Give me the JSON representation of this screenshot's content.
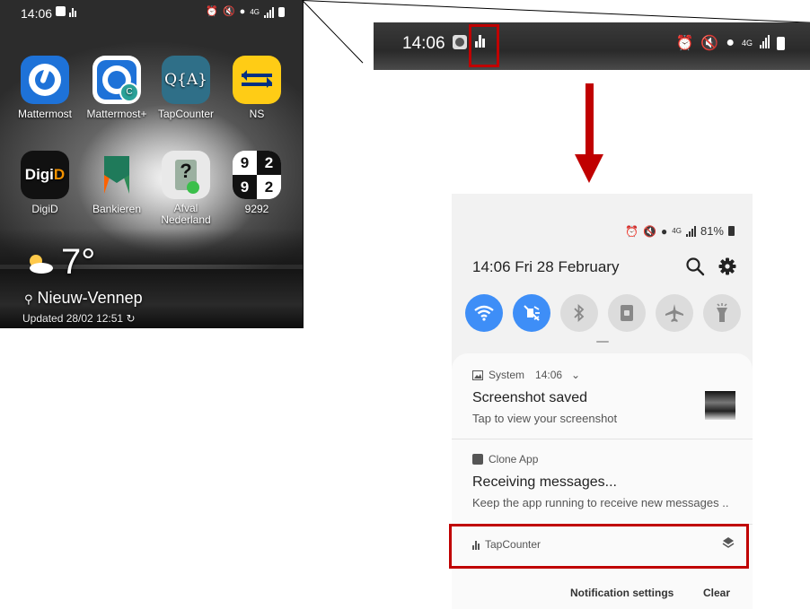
{
  "home": {
    "status_time": "14:06",
    "apps": [
      {
        "label": "Mattermost"
      },
      {
        "label": "Mattermost+"
      },
      {
        "label": "TapCounter",
        "icon_text": "Q{A}"
      },
      {
        "label": "NS"
      },
      {
        "label": "DigiD",
        "icon_text_a": "Digi",
        "icon_text_b": "D"
      },
      {
        "label": "Bankieren"
      },
      {
        "label": "Afval Nederland",
        "icon_text": "?"
      },
      {
        "label": "9292",
        "icon_digits": [
          "9",
          "2",
          "9",
          "2"
        ]
      }
    ],
    "weather_temp": "7°",
    "location": "Nieuw-Vennep",
    "updated": "Updated 28/02 12:51"
  },
  "zoomed_status": {
    "time": "14:06",
    "network": "4G"
  },
  "shade": {
    "network": "4G",
    "battery": "81%",
    "datetime": "14:06  Fri 28 February",
    "quick_settings": [
      {
        "name": "wifi",
        "state": "on"
      },
      {
        "name": "mute",
        "state": "on"
      },
      {
        "name": "bluetooth",
        "state": "off"
      },
      {
        "name": "screen-lock",
        "state": "off"
      },
      {
        "name": "airplane",
        "state": "off"
      },
      {
        "name": "flashlight",
        "state": "off"
      }
    ],
    "notifications": [
      {
        "app": "System",
        "time": "14:06",
        "title": "Screenshot saved",
        "text": "Tap to view your screenshot"
      },
      {
        "app": "Clone App",
        "title": "Receiving messages...",
        "text": "Keep the app running to receive new messages .."
      },
      {
        "app": "TapCounter"
      }
    ],
    "footer": {
      "settings": "Notification settings",
      "clear": "Clear"
    }
  },
  "colors": {
    "highlight": "#c00000",
    "toggle_on": "#3e8ef7"
  }
}
